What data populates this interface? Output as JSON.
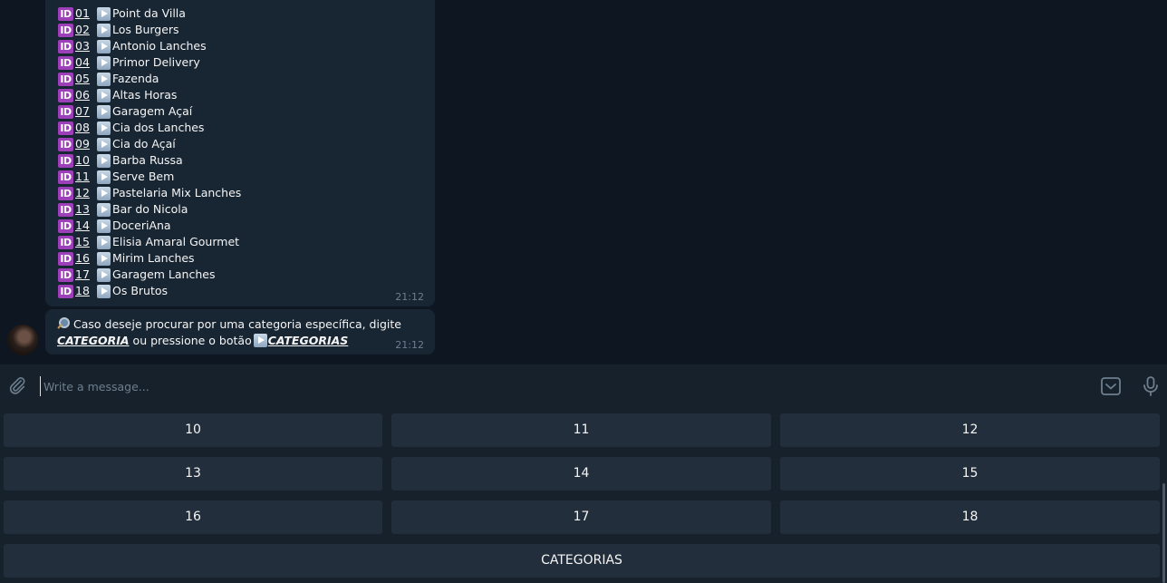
{
  "messages": {
    "list": {
      "id_label": "ID",
      "items": [
        {
          "num": "01",
          "name": "Point da Villa"
        },
        {
          "num": "02",
          "name": "Los Burgers"
        },
        {
          "num": "03",
          "name": "Antonio Lanches"
        },
        {
          "num": "04",
          "name": "Primor Delivery"
        },
        {
          "num": "05",
          "name": "Fazenda"
        },
        {
          "num": "06",
          "name": "Altas Horas"
        },
        {
          "num": "07",
          "name": "Garagem Açaí"
        },
        {
          "num": "08",
          "name": "Cia dos Lanches"
        },
        {
          "num": "09",
          "name": "Cia do Açaí"
        },
        {
          "num": "10",
          "name": "Barba Russa"
        },
        {
          "num": "11",
          "name": "Serve Bem"
        },
        {
          "num": "12",
          "name": "Pastelaria Mix Lanches"
        },
        {
          "num": "13",
          "name": "Bar do Nicola"
        },
        {
          "num": "14",
          "name": "DoceriAna"
        },
        {
          "num": "15",
          "name": "Elisia Amaral Gourmet"
        },
        {
          "num": "16",
          "name": "Mirim Lanches"
        },
        {
          "num": "17",
          "name": "Garagem Lanches"
        },
        {
          "num": "18",
          "name": "Os Brutos"
        }
      ],
      "time": "21:12"
    },
    "note": {
      "text_1": "Caso deseje procurar por uma categoria específica, digite",
      "keyword_1": "CATEGORIA",
      "text_2": "ou pressione o botão",
      "keyword_2": "CATEGORIAS",
      "time": "21:12"
    }
  },
  "composer": {
    "placeholder": "Write a message..."
  },
  "keyboard": {
    "buttons": [
      "10",
      "11",
      "12",
      "13",
      "14",
      "15",
      "16",
      "17",
      "18"
    ],
    "wide_button": "CATEGORIAS"
  },
  "icons": {
    "attach": "paperclip-icon",
    "bot_keyboard": "bot-keyboard-icon",
    "mic": "microphone-icon",
    "id": "id-icon",
    "play": "play-button-icon",
    "search": "magnifier-icon"
  },
  "colors": {
    "background": "#0e1621",
    "bubble": "#182533",
    "panel": "#17212b",
    "button": "#232e3c",
    "id_badge": "#9c3fb8"
  }
}
